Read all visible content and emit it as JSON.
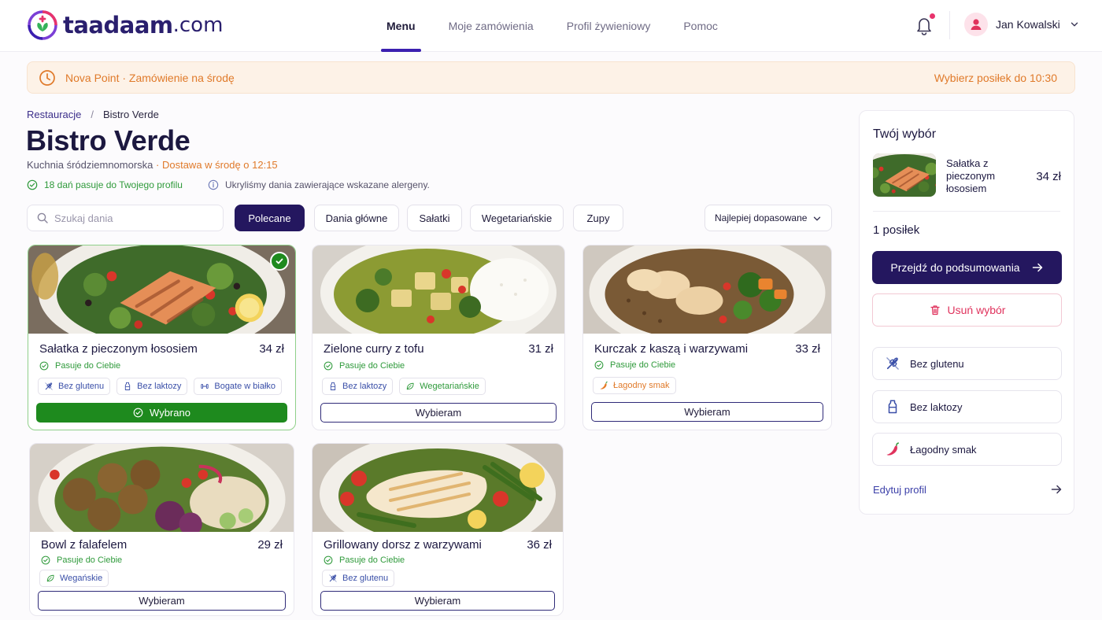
{
  "brand": {
    "name": "taadaam",
    "domain": ".com"
  },
  "nav": {
    "items": [
      {
        "label": "Menu",
        "active": true
      },
      {
        "label": "Moje zamówienia",
        "active": false
      },
      {
        "label": "Profil żywieniowy",
        "active": false
      },
      {
        "label": "Pomoc",
        "active": false
      }
    ]
  },
  "user": {
    "name": "Jan Kowalski"
  },
  "banner": {
    "left": "Nova Point · Zamówienie na środę",
    "right": "Wybierz posiłek do 10:30"
  },
  "breadcrumb": {
    "root": "Restauracje",
    "separator": "/",
    "current": "Bistro Verde"
  },
  "restaurant": {
    "name": "Bistro Verde",
    "cuisine": "Kuchnia śródziemnomorska",
    "delivery": "· Dostawa w środę o 12:15",
    "fit_note": "18 dań pasuje do Twojego profilu",
    "allergen_note": "Ukryliśmy dania zawierające wskazane alergeny."
  },
  "filters": {
    "search_placeholder": "Szukaj dania",
    "chips": [
      {
        "label": "Polecane",
        "active": true
      },
      {
        "label": "Dania główne",
        "active": false
      },
      {
        "label": "Sałatki",
        "active": false
      },
      {
        "label": "Wegetariańskie",
        "active": false
      },
      {
        "label": "Zupy",
        "active": false
      }
    ],
    "sort_label": "Najlepiej dopasowane"
  },
  "dishes": [
    {
      "name": "Sałatka z pieczonym łososiem",
      "price": "34 zł",
      "fit": "Pasuje do Ciebie",
      "tags": [
        {
          "label": "Bez glutenu",
          "icon": "wheat-off-icon"
        },
        {
          "label": "Bez laktozy",
          "icon": "milk-bottle-icon"
        },
        {
          "label": "Bogate w białko",
          "icon": "dumbbell-icon"
        }
      ],
      "selected": true,
      "button": "Wybrano"
    },
    {
      "name": "Zielone curry z tofu",
      "price": "31 zł",
      "fit": "Pasuje do Ciebie",
      "tags": [
        {
          "label": "Bez laktozy",
          "icon": "milk-bottle-icon"
        },
        {
          "label": "Wegetariańskie",
          "icon": "leaf-icon"
        }
      ],
      "selected": false,
      "button": "Wybieram"
    },
    {
      "name": "Kurczak z kaszą i warzywami",
      "price": "33 zł",
      "fit": "Pasuje do Ciebie",
      "tags": [
        {
          "label": "Łagodny smak",
          "icon": "chili-icon"
        }
      ],
      "selected": false,
      "button": "Wybieram"
    },
    {
      "name": "Bowl z falafelem",
      "price": "29 zł",
      "fit": "Pasuje do Ciebie",
      "tags": [
        {
          "label": "Wegańskie",
          "icon": "leaf-icon"
        }
      ],
      "selected": false,
      "button": "Wybieram"
    },
    {
      "name": "Grillowany dorsz z warzywami",
      "price": "36 zł",
      "fit": "Pasuje do Ciebie",
      "tags": [
        {
          "label": "Bez glutenu",
          "icon": "wheat-off-icon"
        }
      ],
      "selected": false,
      "button": "Wybieram"
    }
  ],
  "sidebar": {
    "title": "Twój wybór",
    "item": {
      "name": "Sałatka z pieczonym łososiem",
      "price": "34 zł"
    },
    "count": "1 posiłek",
    "primary_button": "Przejdź do podsumowania",
    "remove_button": "Usuń wybór",
    "prefs": [
      {
        "label": "Bez glutenu",
        "icon": "wheat-off-icon"
      },
      {
        "label": "Bez laktozy",
        "icon": "milk-bottle-icon"
      },
      {
        "label": "Łagodny smak",
        "icon": "chili-icon"
      }
    ],
    "edit_link": "Edytuj profil"
  },
  "colors": {
    "primary": "#24175f",
    "accent": "#3b1fb0",
    "success": "#1e8a1e",
    "warning": "#e07a2a",
    "danger": "#e0335d"
  }
}
